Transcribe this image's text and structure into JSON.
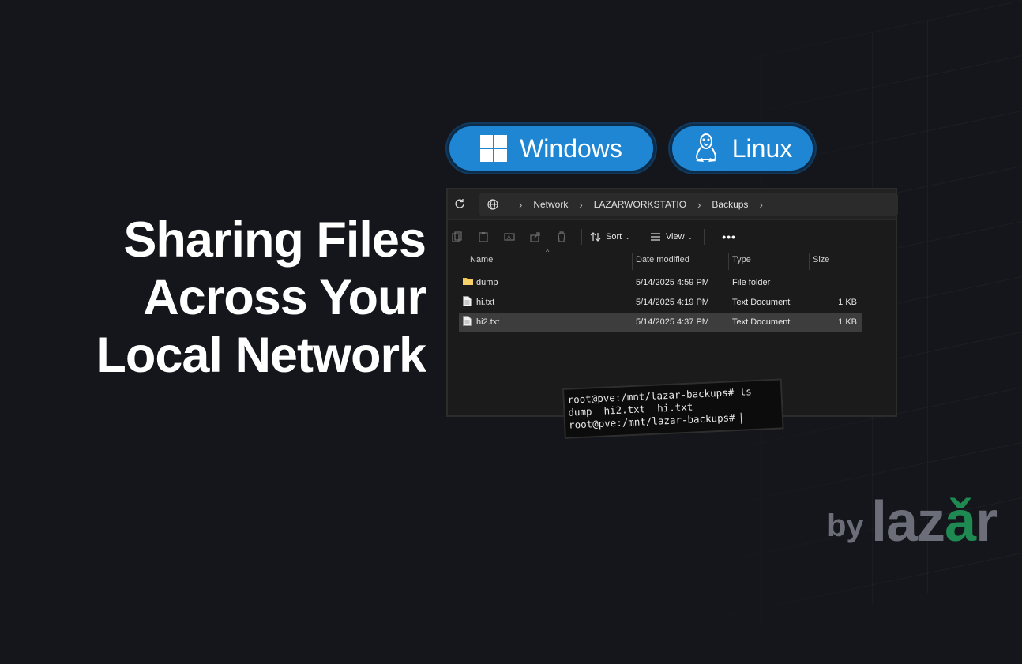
{
  "headline": {
    "line1": "Sharing Files",
    "line2": "Across Your",
    "line3": "Local Network"
  },
  "badges": {
    "windows": {
      "label": "Windows",
      "icon": "windows-logo-icon"
    },
    "linux": {
      "label": "Linux",
      "icon": "tux-penguin-icon"
    }
  },
  "explorer": {
    "breadcrumb": [
      "Network",
      "LAZARWORKSTATIO",
      "Backups"
    ],
    "toolbar": {
      "sort_label": "Sort",
      "view_label": "View",
      "more_label": "•••"
    },
    "columns": {
      "name": "Name",
      "date": "Date modified",
      "type": "Type",
      "size": "Size"
    },
    "rows": [
      {
        "name": "dump",
        "date": "5/14/2025 4:59 PM",
        "type": "File folder",
        "size": "",
        "icon": "folder-icon"
      },
      {
        "name": "hi.txt",
        "date": "5/14/2025 4:19 PM",
        "type": "Text Document",
        "size": "1 KB",
        "icon": "text-file-icon"
      },
      {
        "name": "hi2.txt",
        "date": "5/14/2025 4:37 PM",
        "type": "Text Document",
        "size": "1 KB",
        "icon": "text-file-icon",
        "selected": true
      }
    ]
  },
  "terminal": {
    "line1": "root@pve:/mnt/lazar-backups# ls",
    "line2": "dump  hi2.txt  hi.txt",
    "line3": "root@pve:/mnt/lazar-backups# "
  },
  "brand": {
    "by": "by",
    "name_start": "laz",
    "name_accent": "ǎ",
    "name_end": "r"
  },
  "colors": {
    "background": "#15161b",
    "badge_blue": "#1f86d3",
    "brand_green": "#1e8a52",
    "brand_gray": "#6b6e78"
  }
}
